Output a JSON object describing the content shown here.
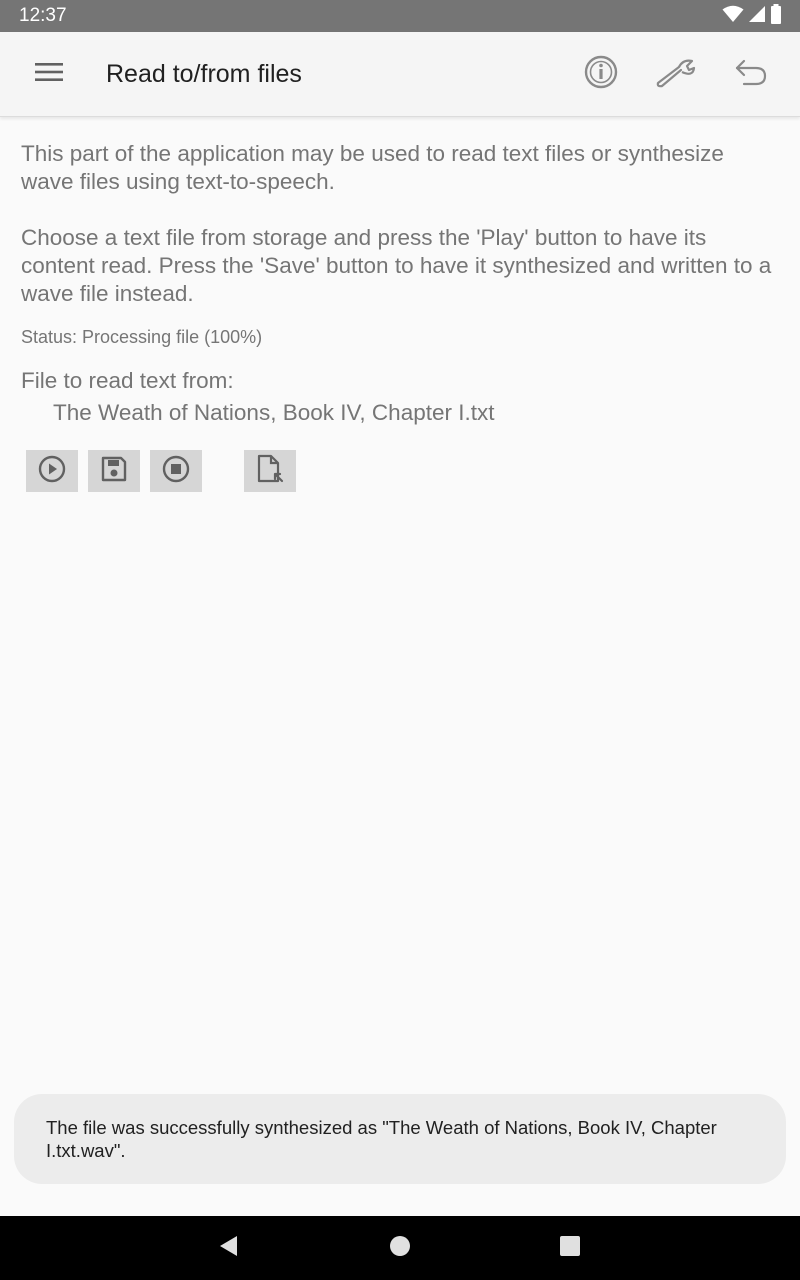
{
  "status_bar": {
    "time": "12:37",
    "icons": [
      "wifi-icon",
      "signal-icon",
      "battery-icon"
    ]
  },
  "app_bar": {
    "title": "Read to/from files",
    "menu_icon": "menu-icon",
    "actions": [
      "info-icon",
      "settings-wrench-icon",
      "back-undo-icon"
    ]
  },
  "main": {
    "intro": "This part of the application may be used to read text files or synthesize wave files using text-to-speech.",
    "instructions": "Choose a text file from storage and press the 'Play' button to have its content read. Press the 'Save' button to have it synthesized and written to a wave file instead.",
    "status": "Status: Processing file (100%)",
    "file_label": "File to read text from:",
    "file_name": "The Weath of Nations, Book IV, Chapter I.txt",
    "buttons": [
      "play-icon",
      "save-icon",
      "stop-icon",
      "choose-file-icon"
    ]
  },
  "toast": {
    "message": "The file was successfully synthesized as \"The Weath of Nations, Book IV, Chapter I.txt.wav\"."
  },
  "nav_bar": {
    "buttons": [
      "back-icon",
      "home-icon",
      "recents-icon"
    ]
  },
  "colors": {
    "status_bar": "#757575",
    "app_bar": "#f5f5f5",
    "background": "#fafafa",
    "button": "#d6d6d6",
    "toast": "#ececec",
    "nav_bar": "#000000",
    "text_primary": "#212121",
    "text_secondary": "#757575"
  }
}
